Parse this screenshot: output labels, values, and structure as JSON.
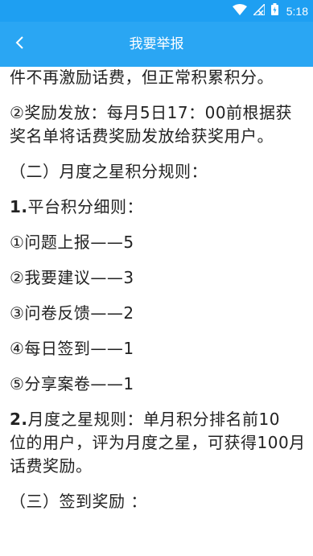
{
  "status_bar": {
    "time": "5:18",
    "icons": [
      "wifi-icon",
      "signal-icon",
      "battery-icon"
    ]
  },
  "app_bar": {
    "title": "我要举报",
    "back_icon": "chevron-left-icon"
  },
  "content": {
    "lines": [
      "件不再激励话费，但正常积累积分。",
      "②奖励发放：每月5日17：00前根据获奖名单将话费奖励发放给获奖用户。",
      "（二）月度之星积分规则：",
      "1.平台积分细则：",
      "①问题上报——5",
      "②我要建议——3",
      "③问卷反馈——2",
      "④每日签到——1",
      "⑤分享案卷——1",
      "位的用户，评为月度之星，可获得100月话费奖励。",
      "（三）签到奖励 ："
    ],
    "rule2_prefix": "2.",
    "rule2_text": "月度之星规则：单月积分排名前10",
    "point1_prefix": "1.",
    "point1_text": "平台积分细则："
  },
  "colors": {
    "status_bar": "#1e9ff2",
    "app_bar": "#2aa6f3",
    "text": "#222222"
  }
}
